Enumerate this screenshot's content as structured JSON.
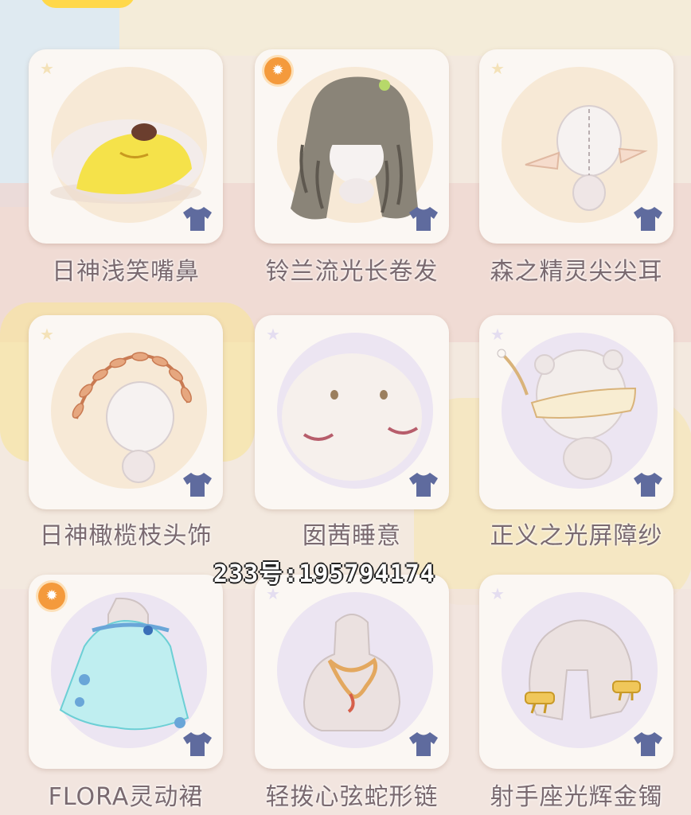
{
  "items": [
    {
      "name": "日神浅笑嘴鼻",
      "bg": "peach",
      "badge": false,
      "icon": "smiling-nose-mouth-icon"
    },
    {
      "name": "铃兰流光长卷发",
      "bg": "peach",
      "badge": true,
      "icon": "long-curly-hair-icon"
    },
    {
      "name": "森之精灵尖尖耳",
      "bg": "peach",
      "badge": false,
      "icon": "elf-ears-icon"
    },
    {
      "name": "日神橄榄枝头饰",
      "bg": "peach",
      "badge": false,
      "icon": "olive-wreath-icon"
    },
    {
      "name": "囡茜睡意",
      "bg": "lav",
      "badge": false,
      "icon": "sleepy-face-icon"
    },
    {
      "name": "正义之光屏障纱",
      "bg": "lav",
      "badge": false,
      "icon": "barrier-veil-icon"
    },
    {
      "name": "FLORA灵动裙",
      "bg": "lav",
      "badge": true,
      "icon": "flora-dress-icon"
    },
    {
      "name": "轻拨心弦蛇形链",
      "bg": "lav",
      "badge": false,
      "icon": "snake-necklace-icon"
    },
    {
      "name": "射手座光辉金镯",
      "bg": "lav",
      "badge": false,
      "icon": "gold-bracelets-icon"
    }
  ],
  "watermark": "233号:195794174",
  "colors": {
    "card_bg": "#fbf7f3",
    "peach_circle": "#f7e9d6",
    "lavender_circle": "#ece5f2",
    "shirt_icon": "#5f6b9e",
    "badge": "#f49a3c",
    "label_text": "#7a6a70"
  }
}
